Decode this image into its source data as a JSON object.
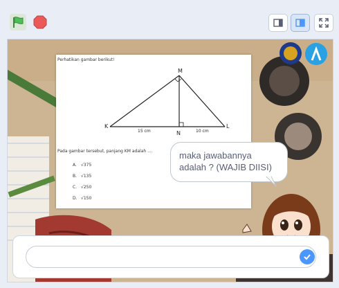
{
  "stage": {
    "question_intro": "Perhatikan gambar berikut!",
    "diagram": {
      "vertex_top": "M",
      "vertex_left": "K",
      "vertex_foot": "N",
      "vertex_right": "L",
      "len_KN": "15 cm",
      "len_NL": "10 cm"
    },
    "question_text": "Pada gambar tersebut, panjang KM adalah ....",
    "options": [
      {
        "letter": "A.",
        "value": "√375"
      },
      {
        "letter": "B.",
        "value": "√135"
      },
      {
        "letter": "C.",
        "value": "√250"
      },
      {
        "letter": "D.",
        "value": "√150"
      }
    ],
    "speech_bubble": "maka jawabannya adalah ? (WAJIB DIISI)"
  },
  "answer": {
    "value": "",
    "placeholder": ""
  },
  "colors": {
    "accent": "#4c97ff",
    "flag": "#4cbf56",
    "stop": "#ec5959"
  }
}
